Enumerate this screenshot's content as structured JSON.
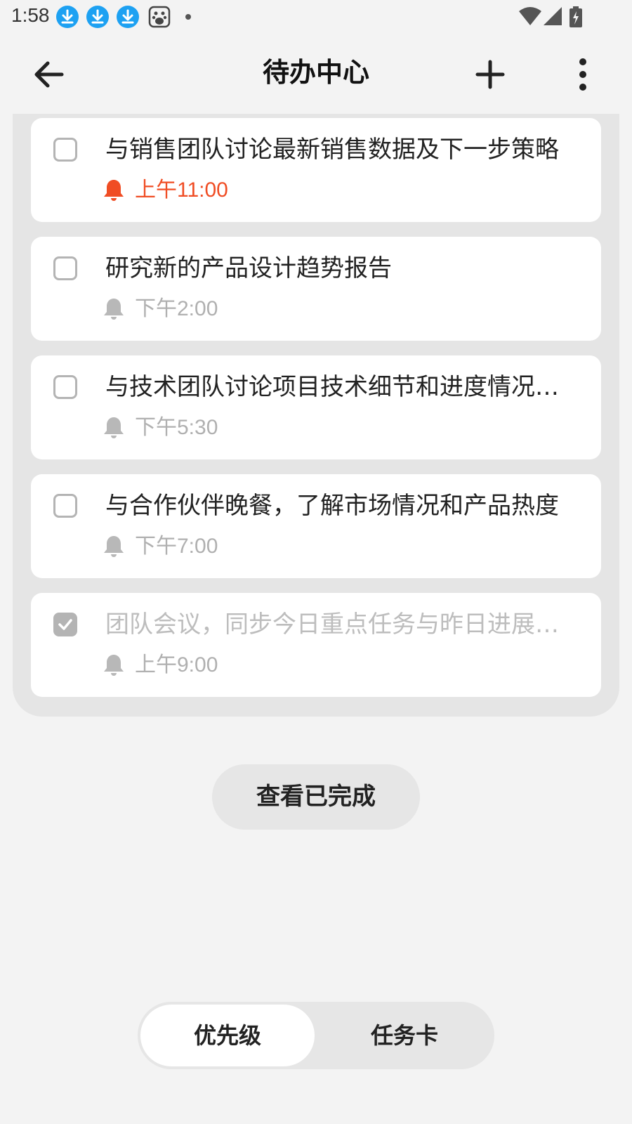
{
  "status_bar": {
    "time": "1:58",
    "icons": [
      "download-icon",
      "download-icon",
      "download-icon",
      "baidu-icon",
      "dot-icon",
      "wifi-icon",
      "signal-icon",
      "battery-charging-icon"
    ]
  },
  "header": {
    "title": "待办中心",
    "back_icon": "arrow-left-icon",
    "add_icon": "plus-icon",
    "more_icon": "more-vert-icon"
  },
  "tasks": [
    {
      "title": "与销售团队讨论最新销售数据及下一步策略",
      "time": "上午11:00",
      "checked": false,
      "urgent": true
    },
    {
      "title": "研究新的产品设计趋势报告",
      "time": "下午2:00",
      "checked": false,
      "urgent": false
    },
    {
      "title": "与技术团队讨论项目技术细节和进度情况…",
      "time": "下午5:30",
      "checked": false,
      "urgent": false
    },
    {
      "title": "与合作伙伴晚餐，了解市场情况和产品热度",
      "time": "下午7:00",
      "checked": false,
      "urgent": false
    },
    {
      "title": "团队会议，同步今日重点任务与昨日进展…",
      "time": "上午9:00",
      "checked": true,
      "urgent": false
    }
  ],
  "view_completed_label": "查看已完成",
  "segments": [
    {
      "label": "优先级",
      "active": true
    },
    {
      "label": "任务卡",
      "active": false
    }
  ],
  "colors": {
    "urgent": "#f04d24",
    "muted": "#b0b0b0",
    "status_download": "#1da1f2",
    "background": "#f3f3f3",
    "card": "#ffffff",
    "list_bg": "#e5e5e5"
  }
}
